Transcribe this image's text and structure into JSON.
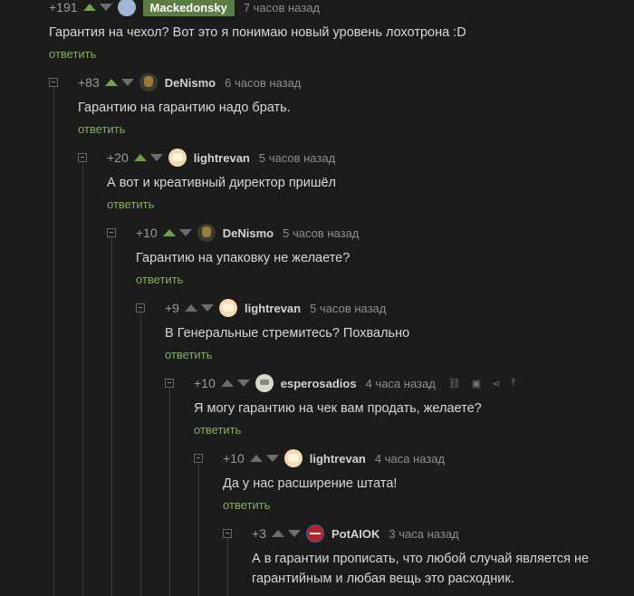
{
  "comments": [
    {
      "rating": "+191",
      "user": "Mackedonsky",
      "time": "7 часов назад",
      "text": "Гарантия на чехол? Вот это я понимаю новый уровень лохотрона :D",
      "reply": "ответить"
    },
    {
      "rating": "+83",
      "user": "DeNismo",
      "time": "6 часов назад",
      "text": "Гарантию на гарантию надо брать.",
      "reply": "ответить"
    },
    {
      "rating": "+20",
      "user": "lightrevan",
      "time": "5 часов назад",
      "text": "А вот и креативный директор пришёл",
      "reply": "ответить"
    },
    {
      "rating": "+10",
      "user": "DeNismo",
      "time": "5 часов назад",
      "text": "Гарантию на упаковку не желаете?",
      "reply": "ответить"
    },
    {
      "rating": "+9",
      "user": "lightrevan",
      "time": "5 часов назад",
      "text": "В Генеральные стремитесь? Похвально",
      "reply": "ответить"
    },
    {
      "rating": "+10",
      "user": "esperosadios",
      "time": "4 часа назад",
      "text": "Я могу гарантию на чек вам продать, желаете?",
      "reply": "ответить"
    },
    {
      "rating": "+10",
      "user": "lightrevan",
      "time": "4 часа назад",
      "text": "Да у нас расширение штата!",
      "reply": "ответить"
    },
    {
      "rating": "+3",
      "user": "PotAIOK",
      "time": "3 часа назад",
      "text_line1": "А в гарантии прописать, что любой случай является не",
      "text_line2": "гарантийным и любая вещь это расходник."
    }
  ],
  "colors": {
    "background": "#1c1c1d",
    "vote_up": "#6aa34a",
    "reply": "#7fb15e",
    "highlight": "#5b7d43"
  },
  "icons": [
    "link-icon",
    "save-icon",
    "share-icon",
    "up-arrow-icon"
  ]
}
